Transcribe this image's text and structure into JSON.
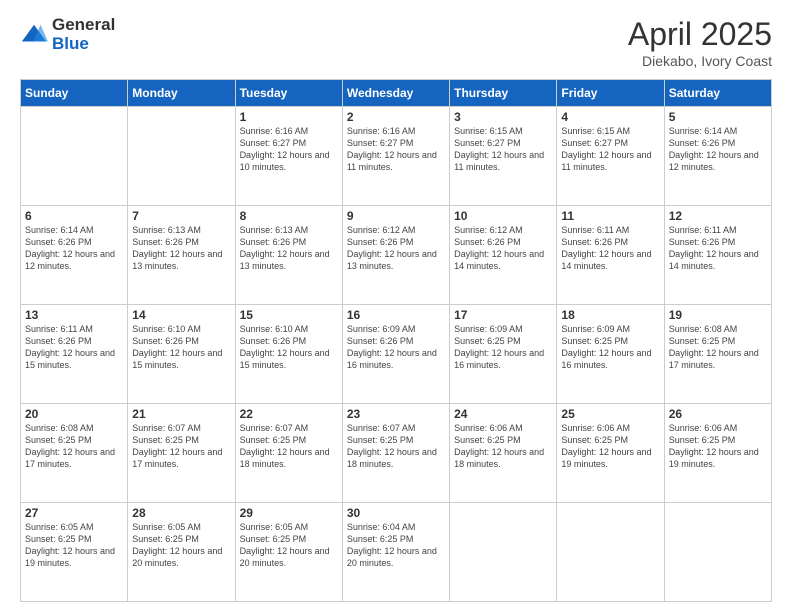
{
  "logo": {
    "general": "General",
    "blue": "Blue"
  },
  "title": {
    "month": "April 2025",
    "location": "Diekabo, Ivory Coast"
  },
  "weekdays": [
    "Sunday",
    "Monday",
    "Tuesday",
    "Wednesday",
    "Thursday",
    "Friday",
    "Saturday"
  ],
  "weeks": [
    [
      {
        "day": "",
        "detail": ""
      },
      {
        "day": "",
        "detail": ""
      },
      {
        "day": "1",
        "detail": "Sunrise: 6:16 AM\nSunset: 6:27 PM\nDaylight: 12 hours and 10 minutes."
      },
      {
        "day": "2",
        "detail": "Sunrise: 6:16 AM\nSunset: 6:27 PM\nDaylight: 12 hours and 11 minutes."
      },
      {
        "day": "3",
        "detail": "Sunrise: 6:15 AM\nSunset: 6:27 PM\nDaylight: 12 hours and 11 minutes."
      },
      {
        "day": "4",
        "detail": "Sunrise: 6:15 AM\nSunset: 6:27 PM\nDaylight: 12 hours and 11 minutes."
      },
      {
        "day": "5",
        "detail": "Sunrise: 6:14 AM\nSunset: 6:26 PM\nDaylight: 12 hours and 12 minutes."
      }
    ],
    [
      {
        "day": "6",
        "detail": "Sunrise: 6:14 AM\nSunset: 6:26 PM\nDaylight: 12 hours and 12 minutes."
      },
      {
        "day": "7",
        "detail": "Sunrise: 6:13 AM\nSunset: 6:26 PM\nDaylight: 12 hours and 13 minutes."
      },
      {
        "day": "8",
        "detail": "Sunrise: 6:13 AM\nSunset: 6:26 PM\nDaylight: 12 hours and 13 minutes."
      },
      {
        "day": "9",
        "detail": "Sunrise: 6:12 AM\nSunset: 6:26 PM\nDaylight: 12 hours and 13 minutes."
      },
      {
        "day": "10",
        "detail": "Sunrise: 6:12 AM\nSunset: 6:26 PM\nDaylight: 12 hours and 14 minutes."
      },
      {
        "day": "11",
        "detail": "Sunrise: 6:11 AM\nSunset: 6:26 PM\nDaylight: 12 hours and 14 minutes."
      },
      {
        "day": "12",
        "detail": "Sunrise: 6:11 AM\nSunset: 6:26 PM\nDaylight: 12 hours and 14 minutes."
      }
    ],
    [
      {
        "day": "13",
        "detail": "Sunrise: 6:11 AM\nSunset: 6:26 PM\nDaylight: 12 hours and 15 minutes."
      },
      {
        "day": "14",
        "detail": "Sunrise: 6:10 AM\nSunset: 6:26 PM\nDaylight: 12 hours and 15 minutes."
      },
      {
        "day": "15",
        "detail": "Sunrise: 6:10 AM\nSunset: 6:26 PM\nDaylight: 12 hours and 15 minutes."
      },
      {
        "day": "16",
        "detail": "Sunrise: 6:09 AM\nSunset: 6:26 PM\nDaylight: 12 hours and 16 minutes."
      },
      {
        "day": "17",
        "detail": "Sunrise: 6:09 AM\nSunset: 6:25 PM\nDaylight: 12 hours and 16 minutes."
      },
      {
        "day": "18",
        "detail": "Sunrise: 6:09 AM\nSunset: 6:25 PM\nDaylight: 12 hours and 16 minutes."
      },
      {
        "day": "19",
        "detail": "Sunrise: 6:08 AM\nSunset: 6:25 PM\nDaylight: 12 hours and 17 minutes."
      }
    ],
    [
      {
        "day": "20",
        "detail": "Sunrise: 6:08 AM\nSunset: 6:25 PM\nDaylight: 12 hours and 17 minutes."
      },
      {
        "day": "21",
        "detail": "Sunrise: 6:07 AM\nSunset: 6:25 PM\nDaylight: 12 hours and 17 minutes."
      },
      {
        "day": "22",
        "detail": "Sunrise: 6:07 AM\nSunset: 6:25 PM\nDaylight: 12 hours and 18 minutes."
      },
      {
        "day": "23",
        "detail": "Sunrise: 6:07 AM\nSunset: 6:25 PM\nDaylight: 12 hours and 18 minutes."
      },
      {
        "day": "24",
        "detail": "Sunrise: 6:06 AM\nSunset: 6:25 PM\nDaylight: 12 hours and 18 minutes."
      },
      {
        "day": "25",
        "detail": "Sunrise: 6:06 AM\nSunset: 6:25 PM\nDaylight: 12 hours and 19 minutes."
      },
      {
        "day": "26",
        "detail": "Sunrise: 6:06 AM\nSunset: 6:25 PM\nDaylight: 12 hours and 19 minutes."
      }
    ],
    [
      {
        "day": "27",
        "detail": "Sunrise: 6:05 AM\nSunset: 6:25 PM\nDaylight: 12 hours and 19 minutes."
      },
      {
        "day": "28",
        "detail": "Sunrise: 6:05 AM\nSunset: 6:25 PM\nDaylight: 12 hours and 20 minutes."
      },
      {
        "day": "29",
        "detail": "Sunrise: 6:05 AM\nSunset: 6:25 PM\nDaylight: 12 hours and 20 minutes."
      },
      {
        "day": "30",
        "detail": "Sunrise: 6:04 AM\nSunset: 6:25 PM\nDaylight: 12 hours and 20 minutes."
      },
      {
        "day": "",
        "detail": ""
      },
      {
        "day": "",
        "detail": ""
      },
      {
        "day": "",
        "detail": ""
      }
    ]
  ]
}
